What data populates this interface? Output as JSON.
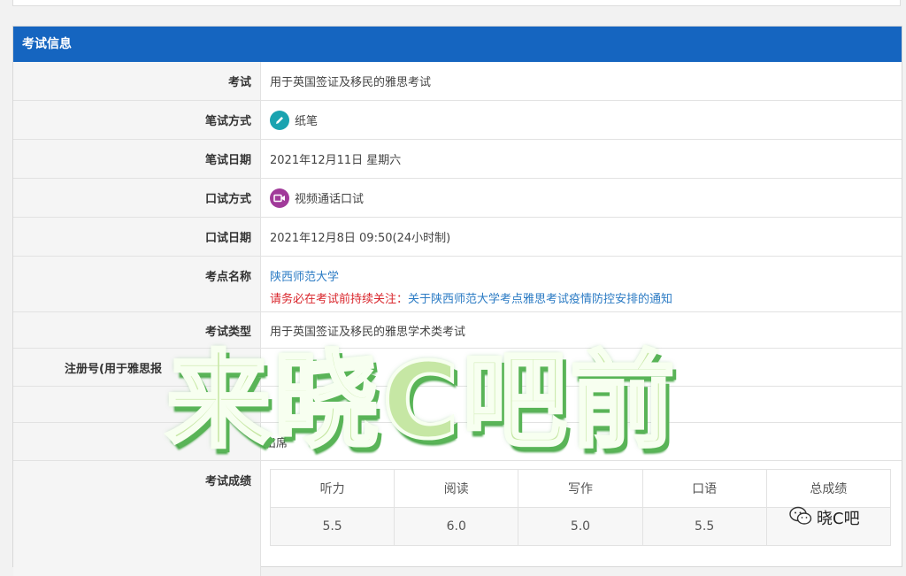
{
  "panel": {
    "title": "考试信息"
  },
  "rows": {
    "exam": {
      "label": "考试",
      "value": "用于英国签证及移民的雅思考试"
    },
    "written_method": {
      "label": "笔试方式",
      "value": "纸笔",
      "icon": "pencil-icon"
    },
    "written_date": {
      "label": "笔试日期",
      "value": "2021年12月11日 星期六"
    },
    "oral_method": {
      "label": "口试方式",
      "value": "视频通话口试",
      "icon": "video-call-icon"
    },
    "oral_date": {
      "label": "口试日期",
      "value": "2021年12月8日 09:50(24小时制)"
    },
    "venue": {
      "label": "考点名称",
      "value": "陕西师范大学",
      "notice_prefix": "请务必在考试前持续关注：",
      "notice_link": "关于陕西师范大学考点雅思考试疫情防控安排的通知"
    },
    "exam_type": {
      "label": "考试类型",
      "value": "用于英国签证及移民的雅思学术类考试"
    },
    "registration": {
      "label": "注册号(用于雅思报"
    },
    "attendance": {
      "value": "出席"
    },
    "scores": {
      "label": "考试成绩"
    }
  },
  "scores_table": {
    "headers": [
      "听力",
      "阅读",
      "写作",
      "口语",
      "总成绩"
    ],
    "values": [
      "5.5",
      "6.0",
      "5.0",
      "5.5",
      ""
    ]
  },
  "overlay": {
    "watermark_text": "来晓C吧前",
    "wechat_account": "晓C吧"
  },
  "colors": {
    "header": "#1565c0",
    "link": "#2b7bc4",
    "notice": "#d9262c",
    "watermark": "#c6e7a4"
  }
}
